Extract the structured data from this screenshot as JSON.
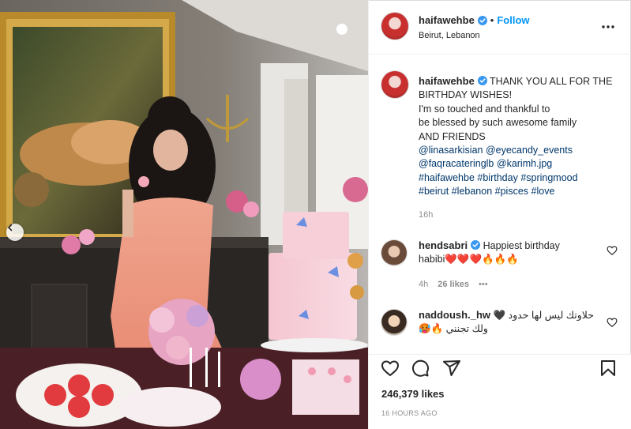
{
  "post": {
    "username": "haifawehbe",
    "follow_label": "Follow",
    "location": "Beirut, Lebanon",
    "caption_lines": [
      "THANK YOU ALL FOR THE",
      "BIRTHDAY WISHES!",
      "I'm so touched and thankful to",
      "be blessed by such awesome family",
      "AND FRIENDS"
    ],
    "mentions": [
      "@linasarkisian",
      "@eyecandy_events",
      "@faqracateringlb",
      "@karimh.jpg"
    ],
    "hashtags": [
      "#haifawehbe",
      "#birthday",
      "#springmood",
      "#beirut",
      "#lebanon",
      "#pisces",
      "#love"
    ],
    "time_ago": "16h",
    "likes": "246,379 likes",
    "posted": "16 HOURS AGO"
  },
  "comments": [
    {
      "username": "hendsabri",
      "text_line1": "Happiest birthday",
      "text_line2": "habibi❤️❤️❤️🔥🔥🔥",
      "time": "4h",
      "likes": "26 likes",
      "more": "•••"
    },
    {
      "username": "naddoush._hw",
      "text_line1": "حلاوتك ليس لها حدود 🖤",
      "text_line2": "ولك تجنني 🔥🥵"
    }
  ],
  "colors": {
    "accent_blue": "#0095f6",
    "tag_blue": "#00376b",
    "heart_red": "#ed4956",
    "muted": "#8e8e8e"
  },
  "icons": [
    "verified-icon",
    "more-icon",
    "heart-icon",
    "comment-icon",
    "share-icon",
    "bookmark-icon",
    "chevron-left-icon"
  ]
}
